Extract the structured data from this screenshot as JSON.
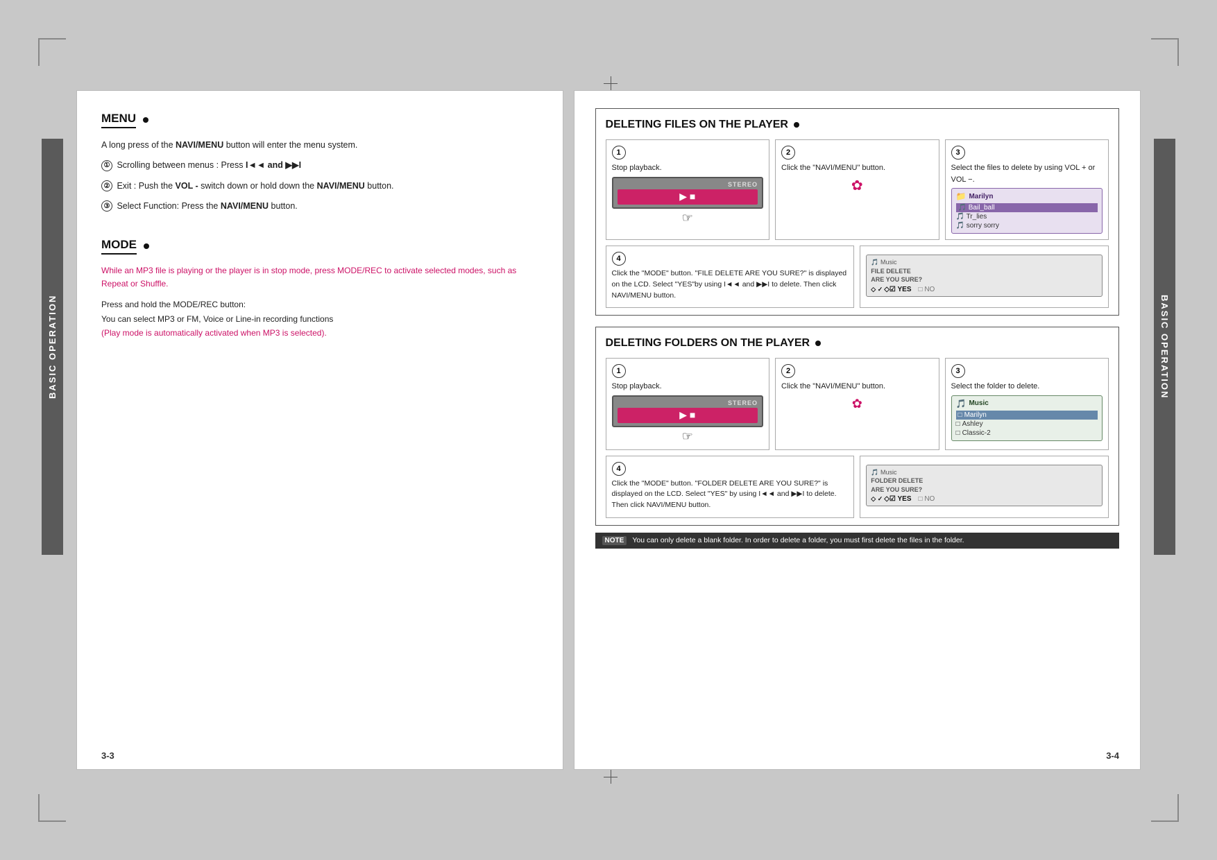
{
  "page": {
    "background_color": "#c8c8c8",
    "left_page_num": "3-3",
    "right_page_num": "3-4",
    "side_tab_text": "BASIC OPERATION"
  },
  "left_page": {
    "menu": {
      "title": "MENU",
      "body_intro": "A long press of the ",
      "navi_menu_bold": "NAVI/MENU",
      "body_intro2": " button will enter the menu system.",
      "items": [
        {
          "circle": "①",
          "text": "Scrolling between menus : Press ",
          "keys": "I◄◄ and ►►I"
        },
        {
          "circle": "②",
          "text": "Exit : Push the ",
          "bold": "VOL -",
          "text2": " switch down or hold down the ",
          "bold2": "NAVI/MENU",
          "text3": " button."
        },
        {
          "circle": "③",
          "text": "Select Function: Press the ",
          "bold": "NAVI/MENU",
          "text2": " button."
        }
      ]
    },
    "mode": {
      "title": "MODE",
      "highlight": "While an MP3 file is playing or the player is in stop mode, press MODE/REC to activate selected modes, such as Repeat or Shuffle.",
      "body": "Press and hold the MODE/REC button:\nYou can select MP3 or FM, Voice or Line-in recording functions",
      "note": "(Play mode is automatically activated when MP3 is selected)."
    }
  },
  "right_page": {
    "delete_files": {
      "title": "DELETING FILES ON THE PLAYER",
      "steps": [
        {
          "num": "1",
          "label": "Stop playback.",
          "stereo": "STEREO",
          "has_device": true
        },
        {
          "num": "2",
          "label": "Click the \"NAVI/MENU\" button.",
          "has_navi": true
        },
        {
          "num": "3",
          "label": "Select the files to delete by using VOL + or VOL −.",
          "has_filelist": true,
          "filelist": {
            "title": "Marilyn",
            "items": [
              "Bail_ball",
              "Tr_lies",
              "sorry sorry"
            ],
            "selected": "Bail_ball"
          }
        },
        {
          "num": "4",
          "text": "Click the \"MODE\" button. \"FILE DELETE ARE YOU SURE?\" is displayed on the LCD. Select \"YES\"by using I◄◄ and ►►I to delete. Then click NAVI/MENU button.",
          "has_confirm": true,
          "confirm": {
            "header": "Music\nFILE DELETE\nARE YOU SURE?",
            "yes": "YES",
            "no": "NO"
          }
        }
      ]
    },
    "delete_folders": {
      "title": "DELETING FOLDERS ON THE PLAYER",
      "steps": [
        {
          "num": "1",
          "label": "Stop playback.",
          "stereo": "STEREO",
          "has_device": true
        },
        {
          "num": "2",
          "label": "Click the \"NAVI/MENU\" button.",
          "has_navi": true
        },
        {
          "num": "3",
          "label": "Select the folder to delete.",
          "has_folderlist": true,
          "folderlist": {
            "title": "Music",
            "items": [
              "Marilyn",
              "Ashley",
              "Classic-2"
            ],
            "selected": "Marilyn"
          }
        },
        {
          "num": "4",
          "text": "Click the \"MODE\" button. \"FOLDER DELETE ARE YOU SURE?\" is displayed on the LCD. Select \"YES\" by using I◄◄ and ►►I to delete. Then click NAVI/MENU button.",
          "has_confirm": true,
          "confirm": {
            "header": "Music\nFOLDER DELETE\nARE YOU SURE?",
            "yes": "YES",
            "no": "NO"
          }
        }
      ]
    },
    "note": "You can only delete a blank folder. In order to delete a folder, you must first delete the files in the folder."
  }
}
